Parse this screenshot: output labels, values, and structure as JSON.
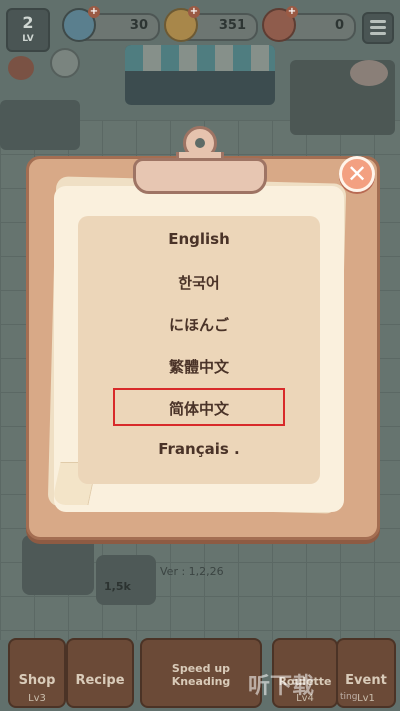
{
  "hud": {
    "level": "2",
    "level_label": "LV",
    "currency_1": "30",
    "currency_2": "351",
    "currency_3": "0"
  },
  "dialog": {
    "languages": [
      "English",
      "한국어",
      "にほんご",
      "繁體中文",
      "简体中文",
      "Français ."
    ],
    "selected_index": 4,
    "close_label": "✕"
  },
  "background": {
    "version": "Ver : 1,2,26",
    "price": "1,5k",
    "bottom_buttons": [
      {
        "label": "Shop",
        "level": "Lv3"
      },
      {
        "label": "Recipe",
        "level": ""
      },
      {
        "label": "Speed up Kneading",
        "level": ""
      },
      {
        "label": "Roulette",
        "level": "Lv4"
      },
      {
        "label": "Event",
        "level": "Lv1"
      }
    ]
  },
  "watermark": {
    "text": "听下载",
    "sub": "ting"
  },
  "colors": {
    "highlight": "#d82a2a",
    "close_button": "#f3a081",
    "board": "#d8a987"
  }
}
